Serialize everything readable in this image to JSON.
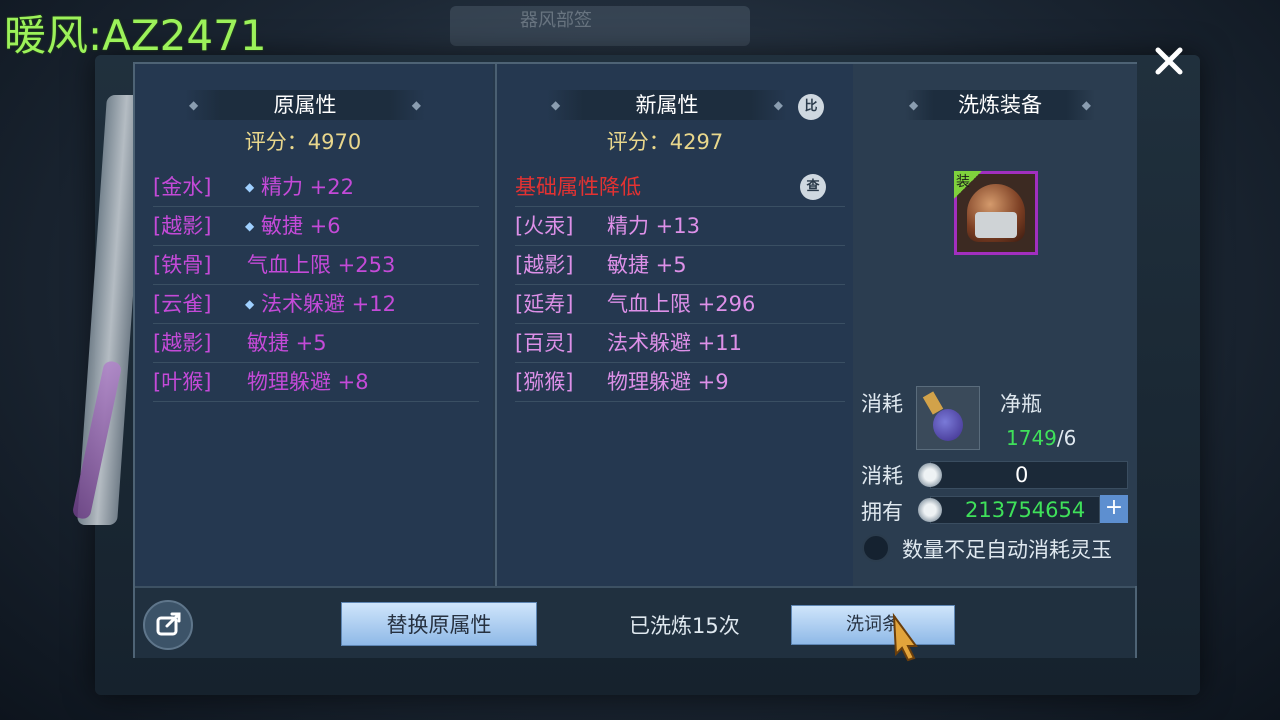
{
  "watermark": "暖风:AZ2471",
  "background": {
    "tab_text": "器风部签"
  },
  "old_attrs": {
    "header": "原属性",
    "score_label": "评分：",
    "score_value": "4970",
    "rows": [
      {
        "tag": "[金水]",
        "diamond": true,
        "text": "精力 +22"
      },
      {
        "tag": "[越影]",
        "diamond": true,
        "text": "敏捷 +6"
      },
      {
        "tag": "[铁骨]",
        "diamond": false,
        "text": "气血上限 +253"
      },
      {
        "tag": "[云雀]",
        "diamond": true,
        "text": "法术躲避 +12"
      },
      {
        "tag": "[越影]",
        "diamond": false,
        "text": "敏捷 +5"
      },
      {
        "tag": "[叶猴]",
        "diamond": false,
        "text": "物理躲避 +8"
      }
    ]
  },
  "new_attrs": {
    "header": "新属性",
    "compare_icon": "比",
    "score_label": "评分：",
    "score_value": "4297",
    "warning": "基础属性降低",
    "warning_icon": "查",
    "rows": [
      {
        "tag": "[火汞]",
        "text": "精力 +13"
      },
      {
        "tag": "[越影]",
        "text": "敏捷 +5"
      },
      {
        "tag": "[延寿]",
        "text": "气血上限 +296"
      },
      {
        "tag": "[百灵]",
        "text": "法术躲避 +11"
      },
      {
        "tag": "[猕猴]",
        "text": "物理躲避 +9"
      }
    ]
  },
  "refine": {
    "header": "洗炼装备",
    "item_badge": "装",
    "consume_label": "消耗",
    "consume_item_name": "净瓶",
    "consume_have": "1749",
    "consume_need": "/6",
    "coin_consume_label": "消耗",
    "coin_consume_value": "0",
    "own_label": "拥有",
    "own_value": "213754654",
    "plus": "+",
    "auto_label": "数量不足自动消耗灵玉"
  },
  "bottom": {
    "replace_button": "替换原属性",
    "refine_count": "已洗炼15次",
    "wash_button": "洗词条"
  },
  "colors": {
    "tag_pink": "#c44ad8",
    "score_yellow": "#e9d78c",
    "warning_red": "#e33232",
    "green_value": "#3fe15a",
    "watermark_green": "#9cf25a"
  }
}
